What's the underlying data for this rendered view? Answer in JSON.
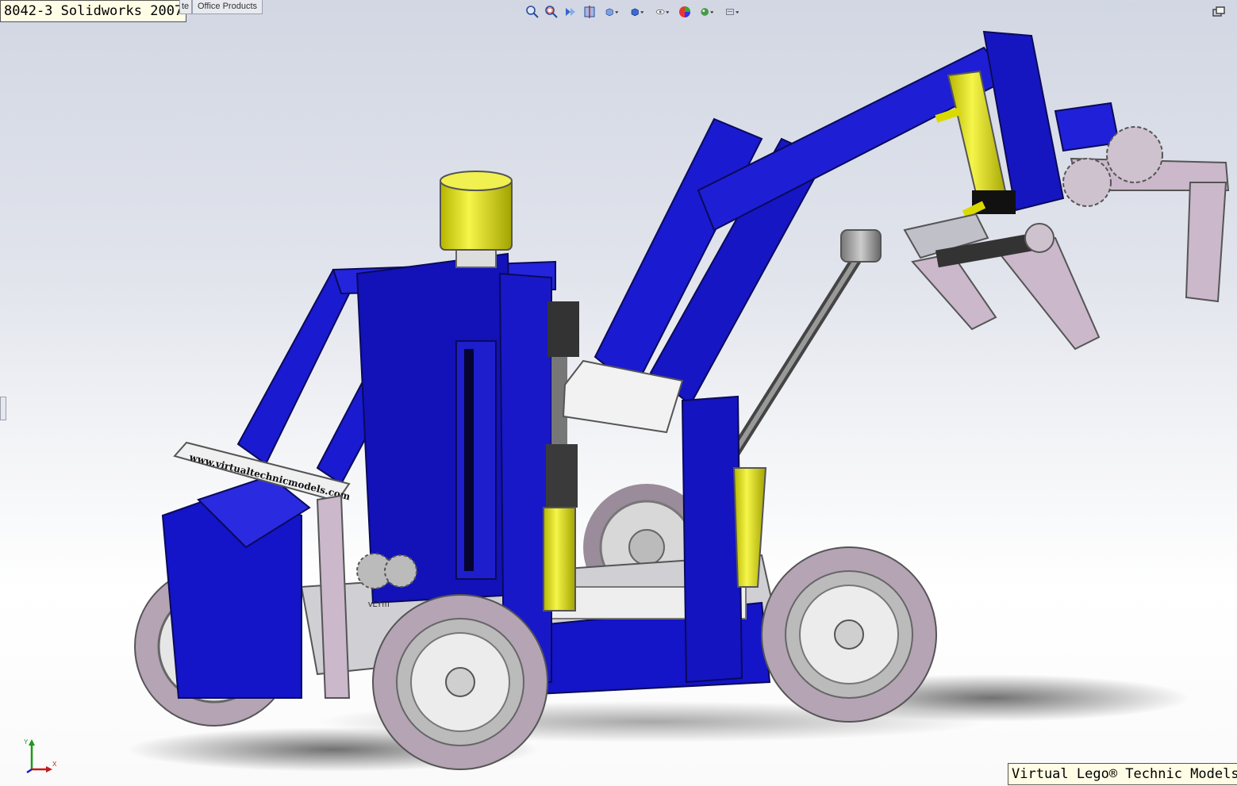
{
  "window": {
    "title": "8042-3 Solidworks 2007"
  },
  "tabs": [
    {
      "label": "te",
      "partial": true
    },
    {
      "label": "Office Products"
    }
  ],
  "view_toolbar": [
    {
      "icon": "zoom-to-fit-icon"
    },
    {
      "icon": "zoom-to-area-icon"
    },
    {
      "icon": "previous-view-icon"
    },
    {
      "icon": "section-view-icon"
    },
    {
      "icon": "view-orientation-icon",
      "dropdown": true
    },
    {
      "icon": "display-style-icon",
      "dropdown": true
    },
    {
      "icon": "hide-show-items-icon",
      "dropdown": true
    },
    {
      "icon": "edit-appearance-icon"
    },
    {
      "icon": "apply-scene-icon",
      "dropdown": true
    },
    {
      "icon": "view-settings-icon",
      "dropdown": true
    }
  ],
  "model": {
    "sign_text": "www.virtualtechnicmodels.com",
    "part_mark": "vLTm",
    "colors": {
      "blue": "#1414c8",
      "blue_dark": "#0a0a78",
      "yellow": "#e6e600",
      "grey": "#a8a8b0",
      "lilac": "#c8b4c8",
      "white": "#f4f4f4",
      "black": "#222222"
    }
  },
  "watermark": "Virtual Lego® Technic Models",
  "triad": {
    "y_label": "Y",
    "x_label": "X"
  }
}
